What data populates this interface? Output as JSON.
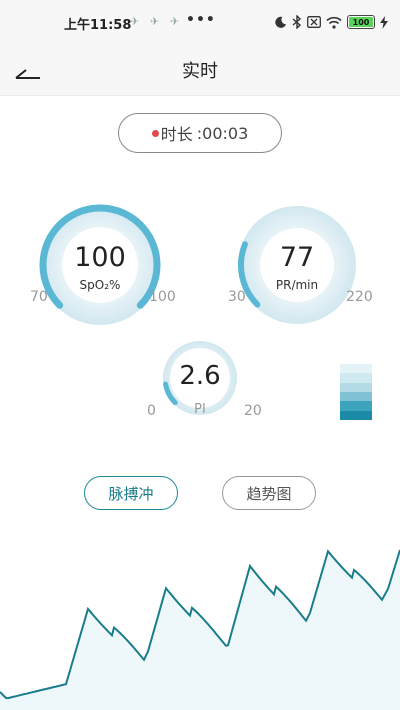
{
  "status_bar": {
    "time": "上午11:58",
    "notification_glyphs": [
      "✈",
      "✈",
      "✈"
    ],
    "more": "•••",
    "battery_level": "100"
  },
  "header": {
    "title": "实时"
  },
  "duration": {
    "label": "时长",
    "value": ":00:03"
  },
  "spo2": {
    "value": "100",
    "unit": "SpO₂%",
    "min": "70",
    "max": "100",
    "level": 1.0,
    "color": "#5bb8d4"
  },
  "pr": {
    "value": "77",
    "unit": "PR/min",
    "min": "30",
    "max": "220",
    "level": 0.247,
    "color": "#5bb8d4"
  },
  "pi": {
    "value": "2.6",
    "unit": "PI",
    "min": "0",
    "max": "20",
    "level": 0.13,
    "color": "#5bb8d4"
  },
  "signal_strength": {
    "level": 0.6,
    "colors": [
      "#e4f3f7",
      "#cfe9f0",
      "#b2dbe6",
      "#7fc2d4",
      "#3ea3bd",
      "#1b8aa6"
    ]
  },
  "tabs": [
    {
      "label": "脉搏冲",
      "selected": true
    },
    {
      "label": "趋势图",
      "selected": false
    }
  ],
  "waveform": {
    "color": "#1a7d8a",
    "fill": "#eef8fa"
  }
}
